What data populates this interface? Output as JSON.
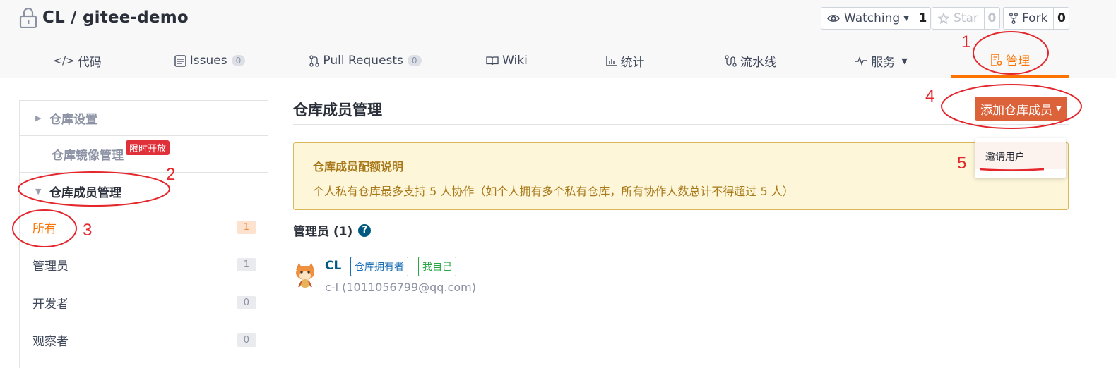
{
  "repo": {
    "title": "CL / gitee-demo"
  },
  "social": {
    "watch": {
      "label": "Watching",
      "count": "1"
    },
    "star": {
      "label": "Star",
      "count": "0"
    },
    "fork": {
      "label": "Fork",
      "count": "0"
    }
  },
  "tabs": [
    {
      "label": "代码",
      "icon": "code-icon"
    },
    {
      "label": "Issues",
      "badge": "0",
      "icon": "issues-icon"
    },
    {
      "label": "Pull Requests",
      "badge": "0",
      "icon": "pull-request-icon"
    },
    {
      "label": "Wiki",
      "icon": "book-icon"
    },
    {
      "label": "统计",
      "icon": "bar-chart-icon"
    },
    {
      "label": "流水线",
      "icon": "pipeline-icon"
    },
    {
      "label": "服务",
      "icon": "pulse-icon"
    },
    {
      "label": "管理",
      "icon": "manage-icon",
      "active": true
    }
  ],
  "sidebar": {
    "repo_settings": "仓库设置",
    "mirror": "仓库镜像管理",
    "mirror_badge": "限时开放",
    "members": "仓库成员管理",
    "items": [
      {
        "label": "所有",
        "count": "1"
      },
      {
        "label": "管理员",
        "count": "1"
      },
      {
        "label": "开发者",
        "count": "0"
      },
      {
        "label": "观察者",
        "count": "0"
      }
    ]
  },
  "main": {
    "title": "仓库成员管理",
    "add_button": "添加仓库成员",
    "dropdown_item": "邀请用户",
    "notice_title": "仓库成员配额说明",
    "notice_text": "个人私有仓库最多支持 5 人协作（如个人拥有多个私有仓库，所有协作人数总计不得超过 5 人）",
    "admins_heading": "管理员 (1)",
    "member": {
      "name": "CL",
      "tag_owner": "仓库拥有者",
      "tag_self": "我自己",
      "sub": "c-l (1011056799@qq.com)"
    }
  },
  "annotations": [
    "1",
    "2",
    "3",
    "4",
    "5"
  ],
  "colors": {
    "accent": "#fe7300",
    "button": "#dc6339",
    "annotation": "#e3272d"
  }
}
